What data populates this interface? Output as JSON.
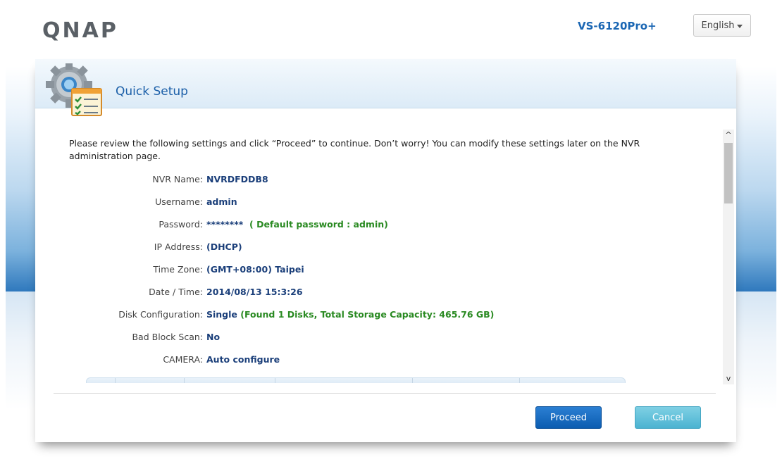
{
  "header": {
    "logo": "QNAP",
    "model": "VS-6120Pro+",
    "language": "English",
    "language_icon": "chevron-down-icon"
  },
  "dialog": {
    "title": "Quick Setup",
    "icon": "gear-checklist-icon",
    "intro": "Please review the following settings and click “Proceed” to continue. Don’t worry! You can modify these settings later on the NVR administration page.",
    "settings": [
      {
        "label": "NVR Name:",
        "value": "NVRDFDDB8",
        "extra": ""
      },
      {
        "label": "Username:",
        "value": "admin",
        "extra": ""
      },
      {
        "label": "Password:",
        "value": "********",
        "extra": "( Default password  :  admin)"
      },
      {
        "label": "IP Address:",
        "value": "(DHCP)",
        "extra": ""
      },
      {
        "label": "Time Zone:",
        "value": "(GMT+08:00) Taipei",
        "extra": ""
      },
      {
        "label": "Date / Time:",
        "value": "2014/08/13 15:3:26",
        "extra": ""
      },
      {
        "label": "Disk Configuration:",
        "value": "Single",
        "extra": "(Found 1 Disks, Total Storage Capacity: 465.76 GB)"
      },
      {
        "label": "Bad Block Scan:",
        "value": "No",
        "extra": ""
      },
      {
        "label": "CAMERA:",
        "value": "Auto configure",
        "extra": ""
      }
    ],
    "buttons": {
      "proceed": "Proceed",
      "cancel": "Cancel"
    },
    "scroll_up": "^",
    "scroll_down": "v"
  },
  "colors": {
    "accent": "#0b5cb0",
    "value_text": "#1b3f7a",
    "highlight_text": "#2a8a22",
    "cancel": "#4bb3d1"
  }
}
